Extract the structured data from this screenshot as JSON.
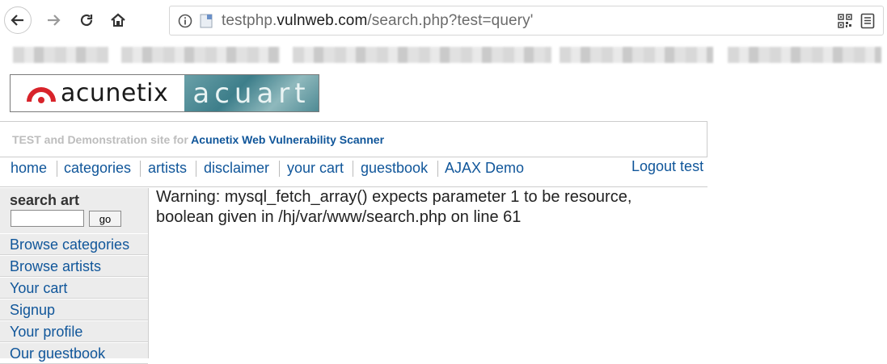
{
  "browser": {
    "url_prefix": "testphp.",
    "url_host": "vulnweb.com",
    "url_path": "/search.php?test=query'"
  },
  "site": {
    "logo_brand": "acunetix",
    "logo_product": "acuart",
    "tagline_prefix": "TEST and Demonstration site for ",
    "tagline_brand": "Acunetix Web Vulnerability Scanner"
  },
  "nav": {
    "items": [
      "home",
      "categories",
      "artists",
      "disclaimer",
      "your cart",
      "guestbook",
      "AJAX Demo"
    ],
    "logout": "Logout test"
  },
  "sidebar": {
    "search_title": "search art",
    "search_value": "",
    "go_label": "go",
    "links": [
      "Browse categories",
      "Browse artists",
      "Your cart",
      "Signup",
      "Your profile",
      "Our guestbook"
    ]
  },
  "content": {
    "warning_line1": "Warning: mysql_fetch_array() expects parameter 1 to be resource,",
    "warning_line2": "boolean given in /hj/var/www/search.php on line 61"
  },
  "colors": {
    "link": "#10569a",
    "logo_red": "#d8232a"
  },
  "icons": {
    "back": "back-arrow-icon",
    "forward": "forward-arrow-icon",
    "reload": "reload-icon",
    "home": "home-icon",
    "info": "info-icon",
    "qr": "qr-code-icon",
    "reader": "reader-view-icon"
  }
}
